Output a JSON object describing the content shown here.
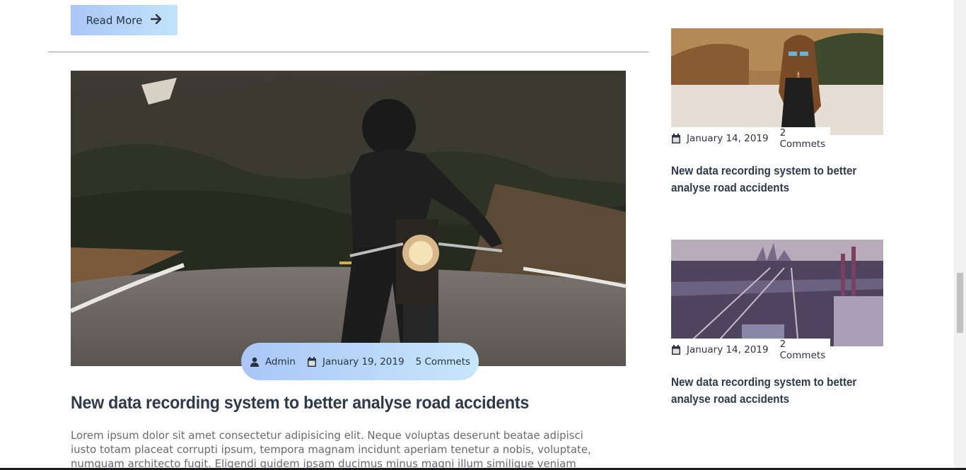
{
  "read_more": {
    "label": "Read More",
    "icon": "arrow-right-icon"
  },
  "main_post": {
    "meta": {
      "author": "Admin",
      "date": "January 19, 2019",
      "comments": "5 Commets"
    },
    "title": "New data recording system to better analyse road accidents",
    "excerpt": "Lorem ipsum dolor sit amet consectetur adipisicing elit. Neque voluptas deserunt beatae adipisci iusto totam placeat corrupti ipsum, tempora magnam incidunt aperiam tenetur a nobis, voluptate, numquam architecto fugit. Eligendi quidem ipsam ducimus minus magni illum similique veniam"
  },
  "sidebar": {
    "posts": [
      {
        "date": "January 14, 2019",
        "comments": "2 Commets",
        "title": "New data recording system to better analyse road accidents"
      },
      {
        "date": "January 14, 2019",
        "comments": "2 Commets",
        "title": "New data recording system to better analyse road accidents"
      }
    ]
  },
  "colors": {
    "accent_start": "#a9c6f7",
    "accent_end": "#c3e4fb",
    "title": "#2d3a4c",
    "text": "#666a70"
  }
}
